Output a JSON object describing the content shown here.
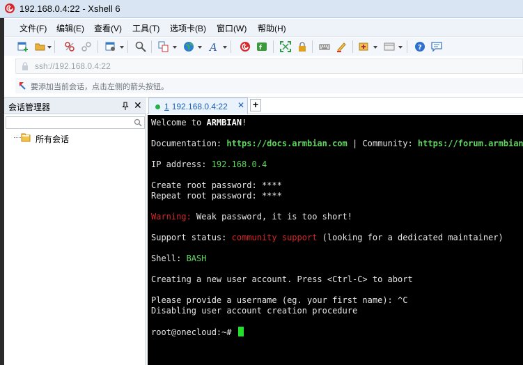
{
  "window": {
    "title": "192.168.0.4:22 - Xshell 6"
  },
  "menu": [
    "文件(F)",
    "编辑(E)",
    "查看(V)",
    "工具(T)",
    "选项卡(B)",
    "窗口(W)",
    "帮助(H)"
  ],
  "address": {
    "value": "ssh://192.168.0.4:22"
  },
  "hint": {
    "text": "要添加当前会话，点击左侧的箭头按钮。"
  },
  "session_panel": {
    "title": "会话管理器",
    "search_placeholder": "",
    "tree": [
      "所有会话"
    ]
  },
  "tabs": [
    {
      "number": "1",
      "label": "192.168.0.4:22",
      "close": "✕"
    }
  ],
  "new_tab": "+",
  "terminal": {
    "welcome_prefix": "Welcome to ",
    "welcome_name": "ARMBIAN",
    "welcome_suffix": "!",
    "doc_label": "Documentation: ",
    "doc_url": "https://docs.armbian.com",
    "community_sep": " | Community: ",
    "community_url": "https://forum.armbian.com",
    "ip_label": "IP address: ",
    "ip_value": "192.168.0.4",
    "create_pw": "Create root password: ****",
    "repeat_pw": "Repeat root password: ****",
    "warning_label": "Warning:",
    "warning_text": " Weak password, it is too short!",
    "support_label": "Support status: ",
    "support_value": "community support",
    "support_note": " (looking for a dedicated maintainer)",
    "shell_label": "Shell: ",
    "shell_value": "BASH",
    "creating": "Creating a new user account. Press <Ctrl-C> to abort",
    "provide": "Please provide a username (eg. your first name): ^C",
    "disabling": "Disabling user account creation procedure",
    "prompt": "root@onecloud:~# "
  },
  "colors": {
    "terminal_bg": "#000000",
    "terminal_fg": "#e6e6e6",
    "terminal_green": "#5fd75f",
    "terminal_red": "#d42828",
    "cursor": "#22e02a",
    "tab_text": "#1a5fb4"
  },
  "icons": [
    "xshell-logo-icon",
    "new-session-icon",
    "open-folder-icon",
    "disconnect-icon",
    "reconnect-icon",
    "properties-icon",
    "search-icon",
    "copy-icon",
    "globe-icon",
    "font-icon",
    "xshell-icon",
    "xftp-icon",
    "fullscreen-icon",
    "lock-icon",
    "keyboard-icon",
    "highlight-icon",
    "add-icon",
    "layout-icon",
    "help-icon",
    "chat-icon",
    "pin-icon",
    "folder-icon",
    "arrow-icon"
  ]
}
